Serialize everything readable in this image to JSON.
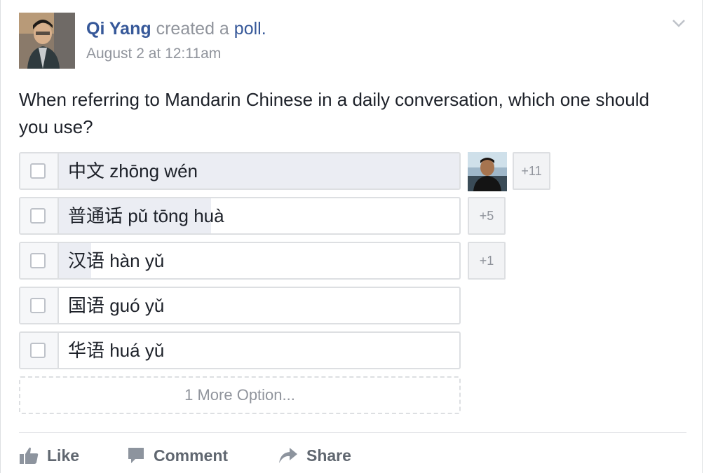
{
  "post": {
    "author": "Qi Yang",
    "action": "created a",
    "object": "poll.",
    "timestamp": "August 2 at 12:11am",
    "question": "When referring to Mandarin Chinese in a daily conversation, which one should you use?"
  },
  "poll": {
    "options": [
      {
        "label": "中文 zhōng wén",
        "fill_pct": 100,
        "more_voters": "+11"
      },
      {
        "label": "普通话 pǔ tōng huà",
        "fill_pct": 38,
        "more_voters": "+5"
      },
      {
        "label": "汉语 hàn yǔ",
        "fill_pct": 8,
        "more_voters": "+1"
      },
      {
        "label": "国语 guó yǔ",
        "fill_pct": 0,
        "more_voters": ""
      },
      {
        "label": "华语 huá yǔ",
        "fill_pct": 0,
        "more_voters": ""
      }
    ],
    "more_options_label": "1 More Option..."
  },
  "actions": {
    "like": "Like",
    "comment": "Comment",
    "share": "Share"
  },
  "colors": {
    "link": "#365899",
    "muted": "#90949c",
    "border": "#dddfe2",
    "vote_fill": "#ebedf3"
  }
}
